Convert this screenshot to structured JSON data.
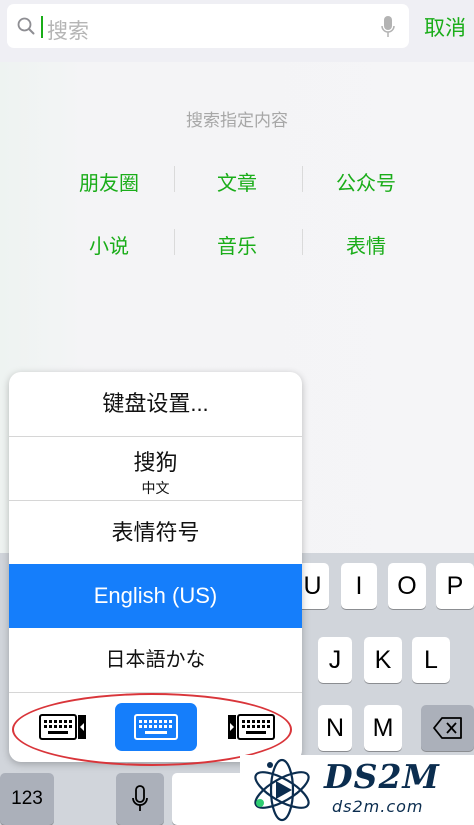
{
  "search": {
    "placeholder": "搜索",
    "cancel_label": "取消"
  },
  "content": {
    "hint": "搜索指定内容",
    "categories_row1": [
      "朋友圈",
      "文章",
      "公众号"
    ],
    "categories_row2": [
      "小说",
      "音乐",
      "表情"
    ]
  },
  "keyboard_menu": {
    "items": [
      {
        "label": "键盘设置...",
        "sublabel": ""
      },
      {
        "label": "搜狗",
        "sublabel": "中文"
      },
      {
        "label": "表情符号",
        "sublabel": ""
      },
      {
        "label": "English (US)",
        "sublabel": "",
        "selected": true
      },
      {
        "label": "日本語かな",
        "sublabel": ""
      }
    ],
    "modes": [
      "keyboard-left-icon",
      "keyboard-full-icon",
      "keyboard-right-icon"
    ],
    "active_mode": "keyboard-full-icon"
  },
  "keyboard": {
    "row1": [
      "U",
      "I",
      "O",
      "P"
    ],
    "row2": [
      "J",
      "K",
      "L"
    ],
    "row3": [
      "N",
      "M"
    ],
    "numbers_label": "123"
  },
  "watermark": {
    "title": "DS2M",
    "url": "ds2m.com"
  },
  "colors": {
    "accent_green": "#1aad19",
    "selection_blue": "#157efb",
    "annotation_red": "#d9353a"
  }
}
